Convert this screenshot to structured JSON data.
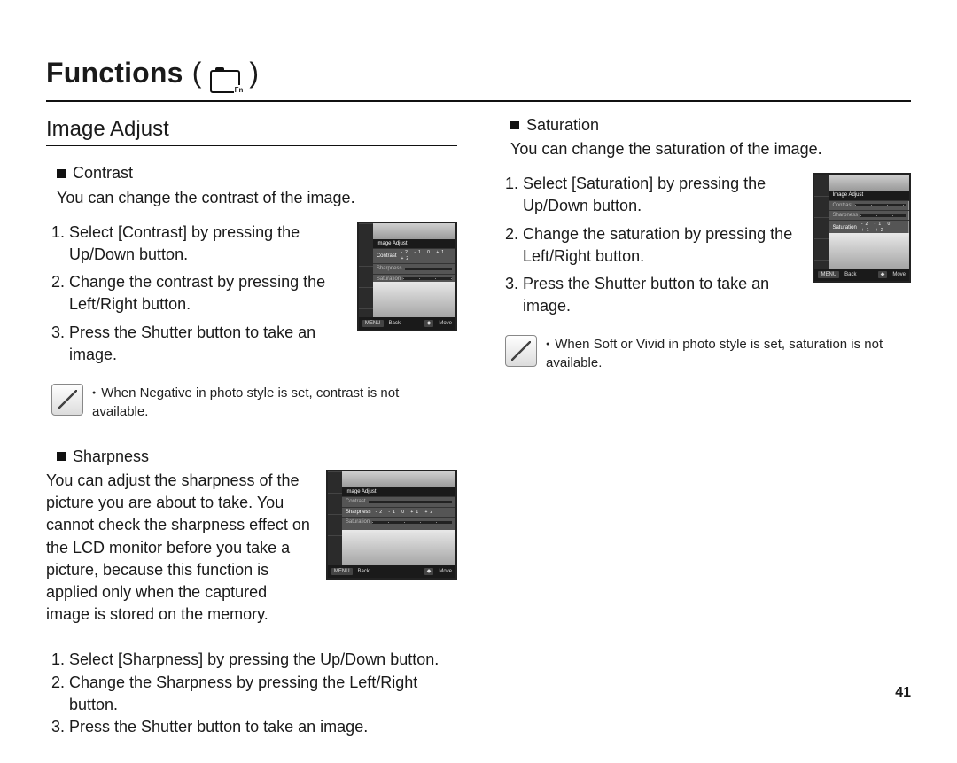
{
  "page_number": "41",
  "header": {
    "title": "Functions"
  },
  "section": {
    "title": "Image Adjust"
  },
  "lcd": {
    "title": "Image Adjust",
    "rows": [
      "Contrast",
      "Sharpness",
      "Saturation"
    ],
    "ticks": "-2  -1   0  +1  +2",
    "footer_back": "Back",
    "footer_move": "Move",
    "footer_back_btn": "MENU"
  },
  "contrast": {
    "heading": "Contrast",
    "lead": "You can change the contrast of the image.",
    "steps": [
      "Select [Contrast] by pressing the Up/Down button.",
      "Change the contrast by pressing the Left/Right button.",
      "Press the Shutter button to take an image."
    ],
    "note": "When Negative in photo style is set, contrast is not available."
  },
  "sharpness": {
    "heading": "Sharpness",
    "lead": "You can adjust the sharpness of the picture you are about to take. You cannot check the sharpness effect on the LCD monitor before you take a picture, because this function is applied only when the captured image is stored on the memory.",
    "steps": [
      "Select [Sharpness] by pressing the Up/Down button.",
      "Change the Sharpness by pressing the Left/Right button.",
      "Press the Shutter button to take an image."
    ]
  },
  "saturation": {
    "heading": "Saturation",
    "lead": "You can change the saturation of the image.",
    "steps": [
      "Select [Saturation] by pressing the Up/Down button.",
      "Change the saturation by pressing the Left/Right button.",
      "Press the Shutter button to take an image."
    ],
    "note": "When Soft or Vivid in photo style is set, saturation is not available."
  }
}
